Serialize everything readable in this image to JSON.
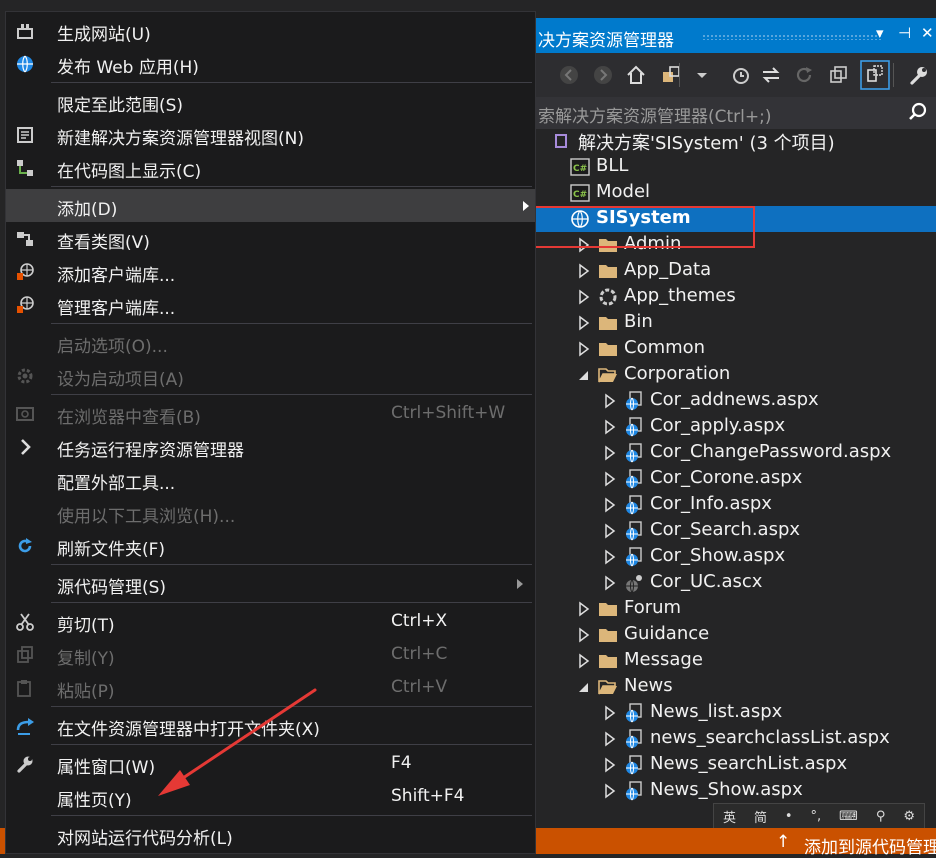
{
  "explorer": {
    "title": "决方案资源管理器",
    "pin_icon": "pin-icon",
    "close_icon": "close-icon",
    "search_placeholder": "索解决方案资源管理器(Ctrl+;)",
    "toolbar_icons": [
      "back-icon",
      "forward-icon",
      "home-icon",
      "switch-views-icon",
      "dropdown-icon",
      "pending-changes-filter-icon",
      "sync-icon",
      "refresh-icon",
      "collapse-all-icon",
      "show-all-files-icon",
      "properties-icon"
    ],
    "tree": [
      {
        "label": "解决方案'SISystem' (3 个项目)",
        "icon": "solution-icon",
        "indent": 0,
        "arrow": "none"
      },
      {
        "label": "BLL",
        "icon": "csharp-project-icon",
        "indent": 1,
        "arrow": "none"
      },
      {
        "label": "Model",
        "icon": "csharp-project-icon",
        "indent": 1,
        "arrow": "none"
      },
      {
        "label": "SISystem",
        "icon": "web-project-icon",
        "indent": 1,
        "arrow": "none",
        "selected": true
      },
      {
        "label": "Admin",
        "icon": "folder-icon",
        "indent": 2,
        "arrow": "right"
      },
      {
        "label": "App_Data",
        "icon": "folder-icon",
        "indent": 2,
        "arrow": "right"
      },
      {
        "label": "App_themes",
        "icon": "theme-icon",
        "indent": 2,
        "arrow": "right"
      },
      {
        "label": "Bin",
        "icon": "folder-icon",
        "indent": 2,
        "arrow": "right"
      },
      {
        "label": "Common",
        "icon": "folder-icon",
        "indent": 2,
        "arrow": "right"
      },
      {
        "label": "Corporation",
        "icon": "folder-open-icon",
        "indent": 2,
        "arrow": "down"
      },
      {
        "label": "Cor_addnews.aspx",
        "icon": "aspx-file-icon",
        "indent": 3,
        "arrow": "right"
      },
      {
        "label": "Cor_apply.aspx",
        "icon": "aspx-file-icon",
        "indent": 3,
        "arrow": "right"
      },
      {
        "label": "Cor_ChangePassword.aspx",
        "icon": "aspx-file-icon",
        "indent": 3,
        "arrow": "right"
      },
      {
        "label": "Cor_Corone.aspx",
        "icon": "aspx-file-icon",
        "indent": 3,
        "arrow": "right"
      },
      {
        "label": "Cor_Info.aspx",
        "icon": "aspx-file-icon",
        "indent": 3,
        "arrow": "right"
      },
      {
        "label": "Cor_Search.aspx",
        "icon": "aspx-file-icon",
        "indent": 3,
        "arrow": "right"
      },
      {
        "label": "Cor_Show.aspx",
        "icon": "aspx-file-icon",
        "indent": 3,
        "arrow": "right"
      },
      {
        "label": "Cor_UC.ascx",
        "icon": "ascx-file-icon",
        "indent": 3,
        "arrow": "right"
      },
      {
        "label": "Forum",
        "icon": "folder-icon",
        "indent": 2,
        "arrow": "right"
      },
      {
        "label": "Guidance",
        "icon": "folder-icon",
        "indent": 2,
        "arrow": "right"
      },
      {
        "label": "Message",
        "icon": "folder-icon",
        "indent": 2,
        "arrow": "right"
      },
      {
        "label": "News",
        "icon": "folder-open-icon",
        "indent": 2,
        "arrow": "down"
      },
      {
        "label": "News_list.aspx",
        "icon": "aspx-file-icon",
        "indent": 3,
        "arrow": "right"
      },
      {
        "label": "news_searchclassList.aspx",
        "icon": "aspx-file-icon",
        "indent": 3,
        "arrow": "right"
      },
      {
        "label": "News_searchList.aspx",
        "icon": "aspx-file-icon",
        "indent": 3,
        "arrow": "right"
      },
      {
        "label": "News_Show.aspx",
        "icon": "aspx-file-icon",
        "indent": 3,
        "arrow": "right"
      }
    ]
  },
  "ime_bar": {
    "items": [
      "英",
      "简",
      "•",
      "°,",
      "⌨",
      "⚲",
      "⚙"
    ]
  },
  "status_bar": {
    "text": "添加到源代码管理",
    "arrow": "↑"
  },
  "context_menu": {
    "items": [
      {
        "label": "生成网站(U)",
        "shortcut": "",
        "icon": "build-icon",
        "disabled": false,
        "submenu": false,
        "highlight": false
      },
      {
        "label": "发布 Web 应用(H)",
        "shortcut": "",
        "icon": "publish-globe-icon",
        "disabled": false,
        "submenu": false,
        "highlight": false
      },
      {
        "sep": true
      },
      {
        "label": "限定至此范围(S)",
        "shortcut": "",
        "icon": "",
        "disabled": false,
        "submenu": false,
        "highlight": false
      },
      {
        "label": "新建解决方案资源管理器视图(N)",
        "shortcut": "",
        "icon": "new-view-icon",
        "disabled": false,
        "submenu": false,
        "highlight": false
      },
      {
        "label": "在代码图上显示(C)",
        "shortcut": "",
        "icon": "code-map-icon",
        "disabled": false,
        "submenu": false,
        "highlight": false
      },
      {
        "sep": true
      },
      {
        "label": "添加(D)",
        "shortcut": "",
        "icon": "",
        "disabled": false,
        "submenu": true,
        "highlight": true
      },
      {
        "label": "查看类图(V)",
        "shortcut": "",
        "icon": "class-diagram-icon",
        "disabled": false,
        "submenu": false,
        "highlight": false
      },
      {
        "label": "添加客户端库...",
        "shortcut": "",
        "icon": "client-library-icon",
        "disabled": false,
        "submenu": false,
        "highlight": false
      },
      {
        "label": "管理客户端库...",
        "shortcut": "",
        "icon": "client-library-icon",
        "disabled": false,
        "submenu": false,
        "highlight": false
      },
      {
        "sep": true
      },
      {
        "label": "启动选项(O)...",
        "shortcut": "",
        "icon": "",
        "disabled": true,
        "submenu": false,
        "highlight": false
      },
      {
        "label": "设为启动项目(A)",
        "shortcut": "",
        "icon": "gear-icon",
        "disabled": true,
        "submenu": false,
        "highlight": false
      },
      {
        "sep": true
      },
      {
        "label": "在浏览器中查看(B)",
        "shortcut": "Ctrl+Shift+W",
        "icon": "browser-icon",
        "disabled": true,
        "submenu": false,
        "highlight": false
      },
      {
        "label": "任务运行程序资源管理器",
        "shortcut": "",
        "icon": "chevron-right-icon",
        "disabled": false,
        "submenu": false,
        "highlight": false
      },
      {
        "label": "配置外部工具...",
        "shortcut": "",
        "icon": "",
        "disabled": false,
        "submenu": false,
        "highlight": false
      },
      {
        "label": "使用以下工具浏览(H)...",
        "shortcut": "",
        "icon": "",
        "disabled": true,
        "submenu": false,
        "highlight": false
      },
      {
        "label": "刷新文件夹(F)",
        "shortcut": "",
        "icon": "refresh-icon",
        "disabled": false,
        "submenu": false,
        "highlight": false
      },
      {
        "sep": true
      },
      {
        "label": "源代码管理(S)",
        "shortcut": "",
        "icon": "",
        "disabled": false,
        "submenu": true,
        "highlight": false
      },
      {
        "sep": true
      },
      {
        "label": "剪切(T)",
        "shortcut": "Ctrl+X",
        "icon": "scissors-icon",
        "disabled": false,
        "submenu": false,
        "highlight": false
      },
      {
        "label": "复制(Y)",
        "shortcut": "Ctrl+C",
        "icon": "copy-icon",
        "disabled": true,
        "submenu": false,
        "highlight": false
      },
      {
        "label": "粘贴(P)",
        "shortcut": "Ctrl+V",
        "icon": "paste-icon",
        "disabled": true,
        "submenu": false,
        "highlight": false
      },
      {
        "sep": true
      },
      {
        "label": "在文件资源管理器中打开文件夹(X)",
        "shortcut": "",
        "icon": "open-folder-arrow-icon",
        "disabled": false,
        "submenu": false,
        "highlight": false
      },
      {
        "sep": true
      },
      {
        "label": "属性窗口(W)",
        "shortcut": "F4",
        "icon": "wrench-icon",
        "disabled": false,
        "submenu": false,
        "highlight": false
      },
      {
        "label": "属性页(Y)",
        "shortcut": "Shift+F4",
        "icon": "",
        "disabled": false,
        "submenu": false,
        "highlight": false
      },
      {
        "sep": true
      },
      {
        "label": "对网站运行代码分析(L)",
        "shortcut": "",
        "icon": "",
        "disabled": false,
        "submenu": false,
        "highlight": false
      }
    ]
  },
  "colors": {
    "accent": "#007acc",
    "selected": "#0e70c0",
    "annotation": "#e53935",
    "status": "#ca5100"
  }
}
